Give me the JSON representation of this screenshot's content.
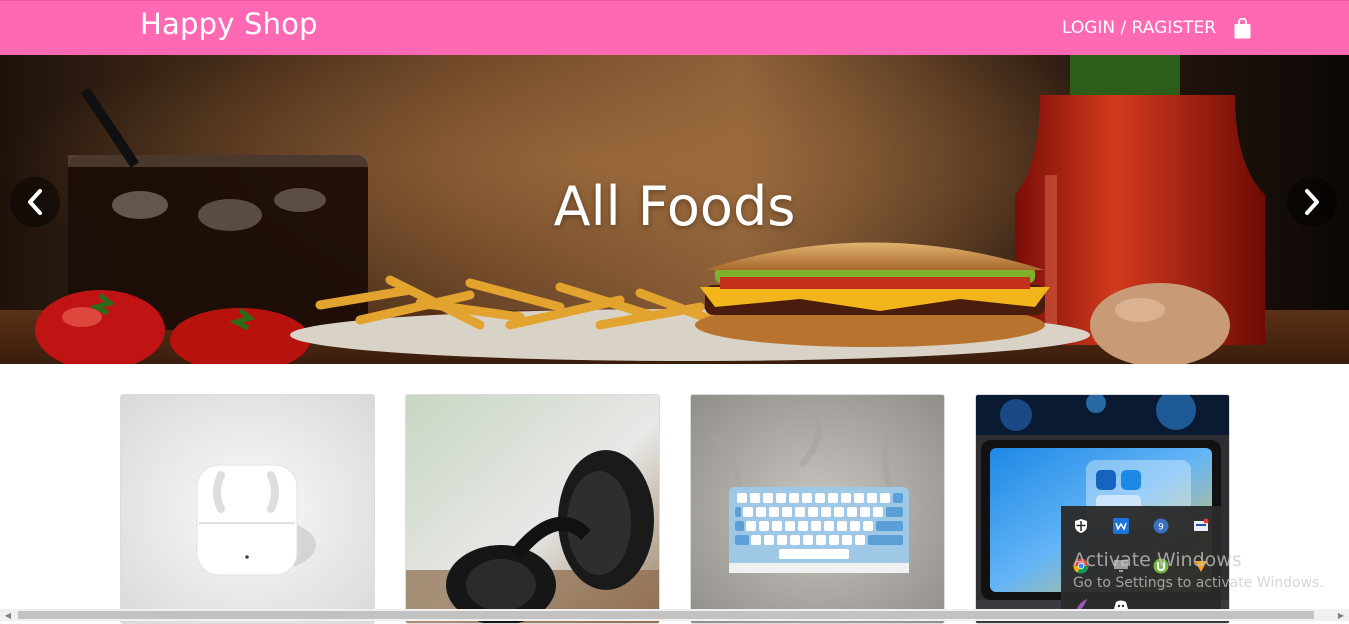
{
  "navbar": {
    "brand": "Happy Shop",
    "login_label": "LOGIN / RAGISTER",
    "bag_icon": "shopping-bag-icon",
    "background": "#ff69b4"
  },
  "hero": {
    "title": "All Foods",
    "prev_icon": "chevron-left-icon",
    "next_icon": "chevron-right-icon"
  },
  "products": [
    {
      "image": "airpods-image"
    },
    {
      "image": "headphones-image"
    },
    {
      "image": "keyboard-image"
    },
    {
      "image": "tablet-image"
    }
  ],
  "system_overlay": {
    "watermark_title": "Activate Windows",
    "watermark_subtitle": "Go to Settings to activate Windows.",
    "tray_badge": "9"
  }
}
